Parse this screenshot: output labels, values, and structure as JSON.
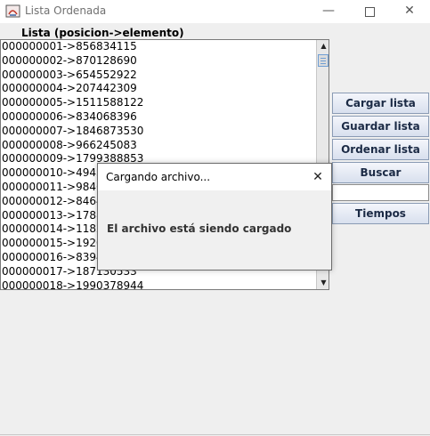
{
  "window": {
    "title": "Lista Ordenada",
    "minimize_glyph": "—",
    "close_glyph": "✕",
    "icon": "java-app-icon"
  },
  "list": {
    "label": "Lista (posicion->elemento)",
    "items": [
      "000000001->856834115",
      "000000002->870128690",
      "000000003->654552922",
      "000000004->207442309",
      "000000005->1511588122",
      "000000006->834068396",
      "000000007->1846873530",
      "000000008->966245083",
      "000000009->1799388853",
      "000000010->49438",
      "000000011->98467",
      "000000012->84645",
      "000000013->17880",
      "000000014->11824",
      "000000015->19206",
      "000000016->83942",
      "000000017->187130533",
      "000000018->1990378944"
    ]
  },
  "scrollbar": {
    "up_glyph": "▲",
    "down_glyph": "▼"
  },
  "buttons": {
    "load": "Cargar lista",
    "save": "Guardar lista",
    "sort": "Ordenar lista",
    "search": "Buscar",
    "times": "Tiempos"
  },
  "search_field": {
    "value": ""
  },
  "dialog": {
    "title": "Cargando archivo...",
    "close_glyph": "✕",
    "message": "El archivo está siendo cargado"
  }
}
